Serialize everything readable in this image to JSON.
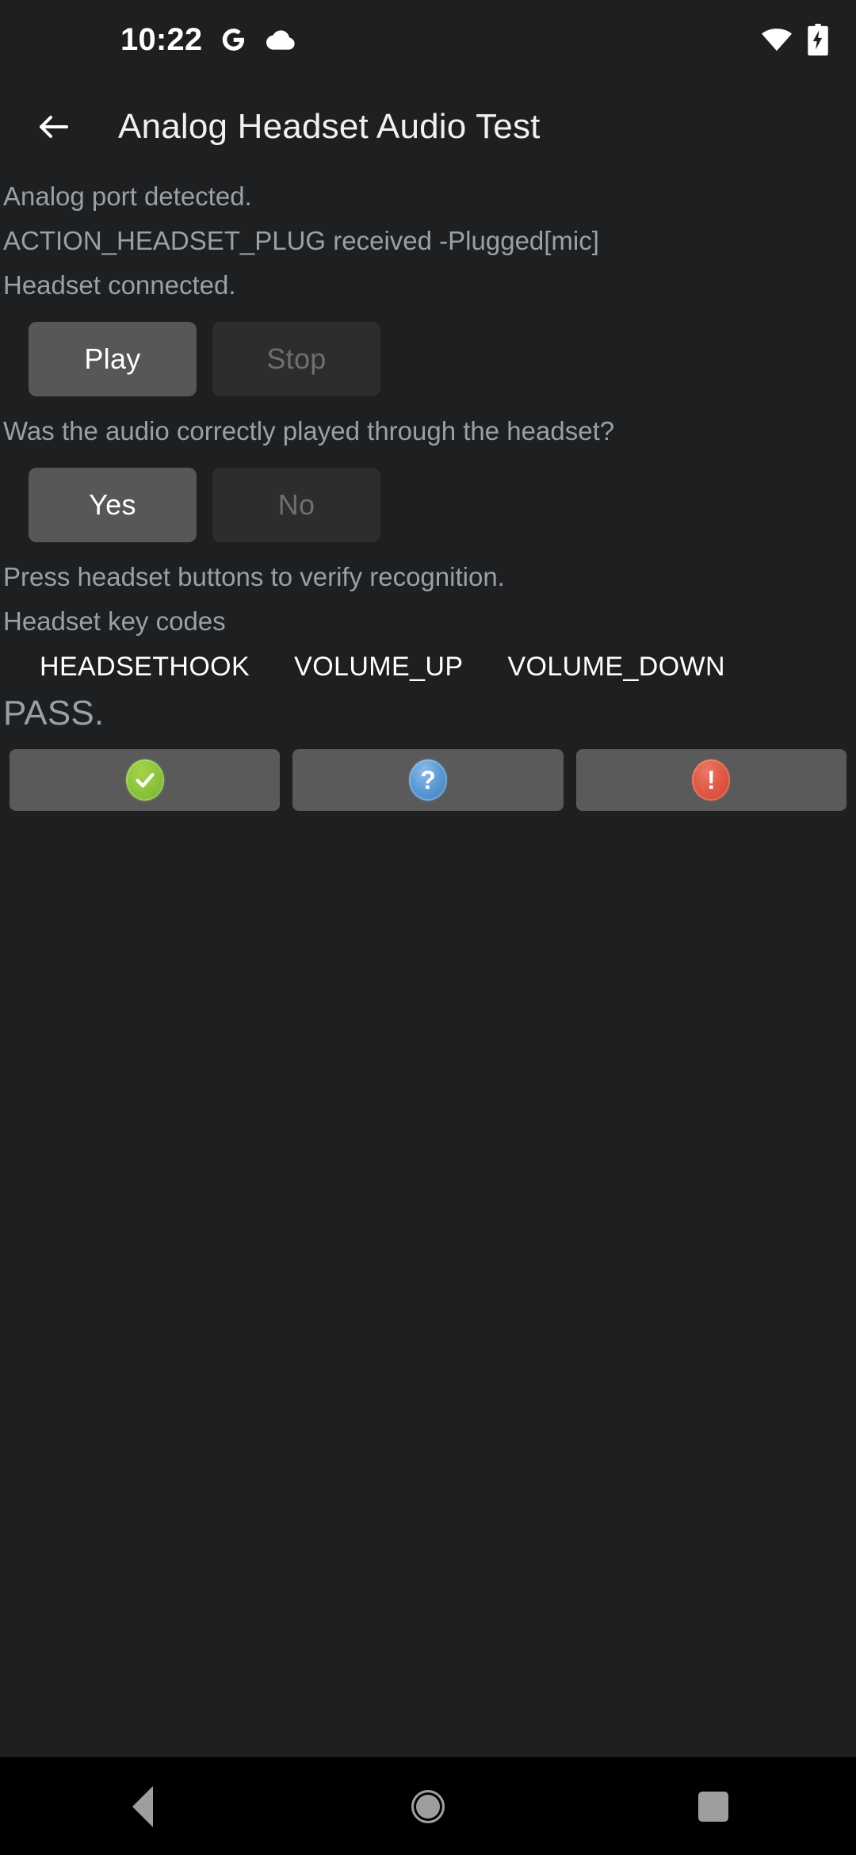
{
  "status_bar": {
    "time": "10:22",
    "icons_left": [
      "google-g-icon",
      "cloud-icon"
    ],
    "icons_right": [
      "wifi-icon",
      "battery-charging-icon"
    ]
  },
  "app_bar": {
    "back_icon": "back-arrow-icon",
    "title": "Analog Headset Audio Test"
  },
  "main": {
    "status_lines": [
      "Analog port detected.",
      "ACTION_HEADSET_PLUG received -Plugged[mic]",
      "Headset connected."
    ],
    "playback_controls": {
      "play_label": "Play",
      "play_enabled": true,
      "stop_label": "Stop",
      "stop_enabled": false
    },
    "question": "Was the audio correctly played through the headset?",
    "answer_controls": {
      "yes_label": "Yes",
      "yes_enabled": true,
      "no_label": "No",
      "no_enabled": false
    },
    "instruction": "Press headset buttons to verify recognition.",
    "keycodes_label": "Headset key codes",
    "keycodes": [
      "HEADSETHOOK",
      "VOLUME_UP",
      "VOLUME_DOWN"
    ],
    "result": "PASS."
  },
  "verdict_bar": {
    "buttons": [
      {
        "name": "pass-button",
        "icon": "check-circle-icon",
        "glyph": "✔",
        "color": "#8cc63e"
      },
      {
        "name": "info-button",
        "icon": "question-circle-icon",
        "glyph": "?",
        "color": "#5b9bd5"
      },
      {
        "name": "fail-button",
        "icon": "exclamation-circle-icon",
        "glyph": "!",
        "color": "#e05a45"
      }
    ]
  },
  "nav_bar": {
    "back": "back-nav-button",
    "home": "home-nav-button",
    "recents": "recents-nav-button"
  },
  "theme": {
    "background": "#1e1f20",
    "enabled_button": "#575757",
    "disabled_button": "#2d2d2d",
    "secondary_text": "#9aa0a6",
    "primary_text": "#ffffff"
  }
}
